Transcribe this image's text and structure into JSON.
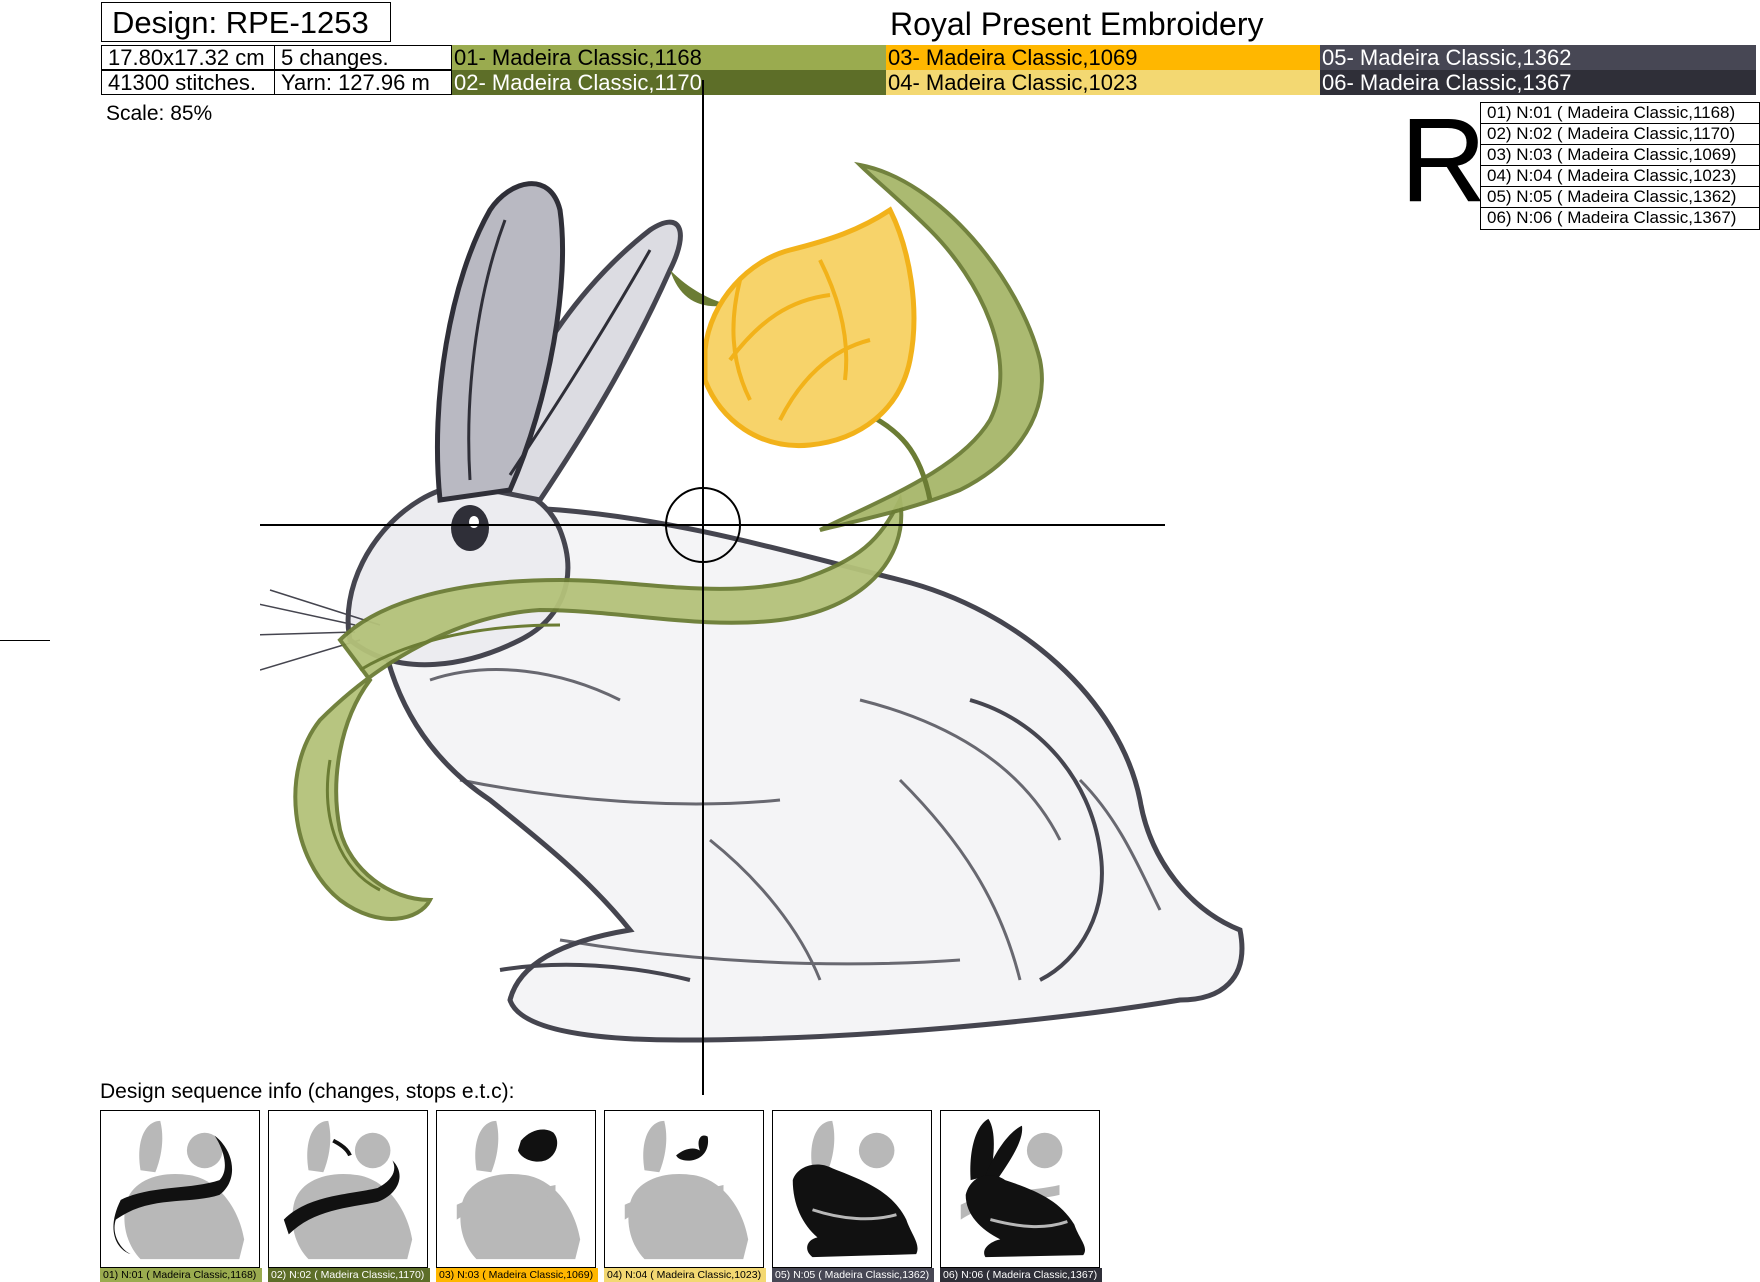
{
  "header": {
    "design_id": "Design: RPE-1253",
    "brand": "Royal Present Embroidery",
    "size": "17.80x17.32 cm",
    "changes": "5 changes.",
    "stitches": "41300 stitches.",
    "yarn": "Yarn: 127.96 m"
  },
  "threads": [
    {
      "label": "01- Madeira Classic,1168",
      "color": "#9aab4f",
      "text_color": "#000000"
    },
    {
      "label": "02- Madeira Classic,1170",
      "color": "#5d6e28",
      "text_color": "#ffffff"
    },
    {
      "label": "03- Madeira Classic,1069",
      "color": "#ffb700",
      "text_color": "#000000"
    },
    {
      "label": "04- Madeira Classic,1023",
      "color": "#f3d872",
      "text_color": "#000000"
    },
    {
      "label": "05- Madeira Classic,1362",
      "color": "#474754",
      "text_color": "#ffffff"
    },
    {
      "label": "06- Madeira Classic,1367",
      "color": "#2f2f38",
      "text_color": "#ffffff"
    }
  ],
  "scale": "Scale: 85%",
  "rotation_mark": "R",
  "legend": [
    "01) N:01 ( Madeira Classic,1168)",
    "02) N:02 ( Madeira Classic,1170)",
    "03) N:03 ( Madeira Classic,1069)",
    "04) N:04 ( Madeira Classic,1023)",
    "05) N:05 ( Madeira Classic,1362)",
    "06) N:06 ( Madeira Classic,1367)"
  ],
  "sequence_label": "Design sequence info (changes, stops e.t.c):",
  "sequence": [
    {
      "caption": "01) N:01 ( Madeira Classic,1168)",
      "color": "#9aab4f",
      "text_color": "#000000"
    },
    {
      "caption": "02) N:02 ( Madeira Classic,1170)",
      "color": "#5d6e28",
      "text_color": "#ffffff"
    },
    {
      "caption": "03) N:03 ( Madeira Classic,1069)",
      "color": "#ffb700",
      "text_color": "#000000"
    },
    {
      "caption": "04) N:04 ( Madeira Classic,1023)",
      "color": "#f3d872",
      "text_color": "#000000"
    },
    {
      "caption": "05) N:05 ( Madeira Classic,1362)",
      "color": "#474754",
      "text_color": "#ffffff"
    },
    {
      "caption": "06) N:06 ( Madeira Classic,1367)",
      "color": "#2f2f38",
      "text_color": "#ffffff"
    }
  ],
  "palette": {
    "bunny": "#45454f",
    "leaf_light": "#9aab4f",
    "leaf_dark": "#6b7c34",
    "tulip": "#f2b21a",
    "ghost": "#b8b8b8"
  }
}
